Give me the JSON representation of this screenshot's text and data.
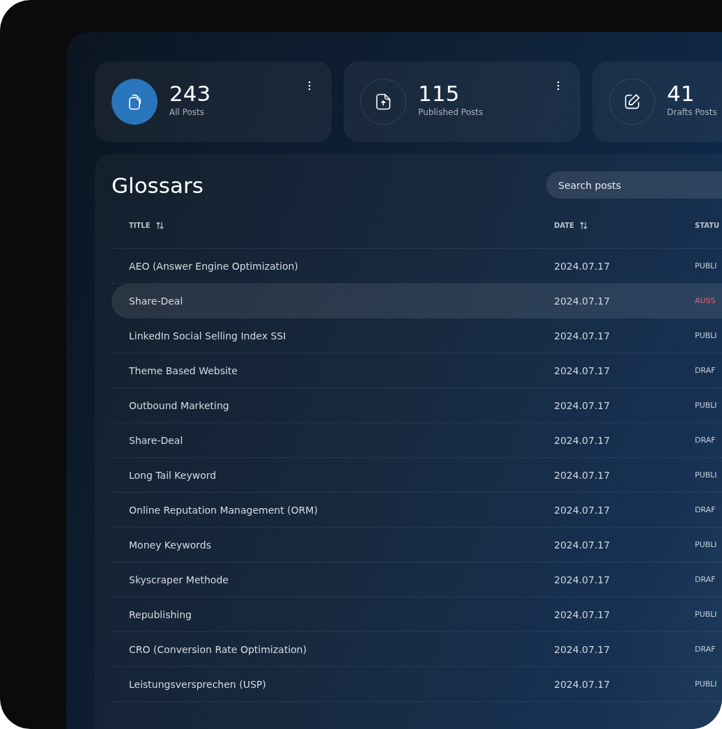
{
  "stats": [
    {
      "value": "243",
      "label": "All Posts",
      "kind": "all",
      "selected": true
    },
    {
      "value": "115",
      "label": "Published Posts",
      "kind": "published",
      "selected": false
    },
    {
      "value": "41",
      "label": "Drafts Posts",
      "kind": "drafts",
      "selected": false
    }
  ],
  "panel": {
    "title": "Glossars",
    "search": {
      "placeholder": "Search posts"
    }
  },
  "table": {
    "columns": [
      {
        "label": "TITLE",
        "sortable": true
      },
      {
        "label": "DATE",
        "sortable": true
      },
      {
        "label": "STATU",
        "sortable": false
      }
    ],
    "rows": [
      {
        "title": "AEO (Answer Engine Optimization)",
        "date": "2024.07.17",
        "status": "PUBLI",
        "color": "#c9ced6",
        "selected": false
      },
      {
        "title": "Share-Deal",
        "date": "2024.07.17",
        "status": "AUSS",
        "color": "#e0676a",
        "selected": true
      },
      {
        "title": "LinkedIn Social Selling Index SSI",
        "date": "2024.07.17",
        "status": "PUBLI",
        "color": "#c9ced6",
        "selected": false
      },
      {
        "title": "Theme Based Website",
        "date": "2024.07.17",
        "status": "DRAF",
        "color": "#c9ced6",
        "selected": false
      },
      {
        "title": "Outbound Marketing",
        "date": "2024.07.17",
        "status": "PUBLI",
        "color": "#c9ced6",
        "selected": false
      },
      {
        "title": "Share-Deal",
        "date": "2024.07.17",
        "status": "DRAF",
        "color": "#c9ced6",
        "selected": false
      },
      {
        "title": "Long Tail Keyword",
        "date": "2024.07.17",
        "status": "PUBLI",
        "color": "#c9ced6",
        "selected": false
      },
      {
        "title": "Online Reputation Management (ORM)",
        "date": "2024.07.17",
        "status": "DRAF",
        "color": "#c9ced6",
        "selected": false
      },
      {
        "title": "Money Keywords",
        "date": "2024.07.17",
        "status": "PUBLI",
        "color": "#c9ced6",
        "selected": false
      },
      {
        "title": "Skyscraper Methode",
        "date": "2024.07.17",
        "status": "DRAF",
        "color": "#c9ced6",
        "selected": false
      },
      {
        "title": "Republishing",
        "date": "2024.07.17",
        "status": "PUBLI",
        "color": "#c9ced6",
        "selected": false
      },
      {
        "title": "CRO (Conversion Rate Optimization)",
        "date": "2024.07.17",
        "status": "DRAF",
        "color": "#c9ced6",
        "selected": false
      },
      {
        "title": "Leistungsversprechen (USP)",
        "date": "2024.07.17",
        "status": "PUBLI",
        "color": "#c9ced6",
        "selected": false
      }
    ]
  }
}
